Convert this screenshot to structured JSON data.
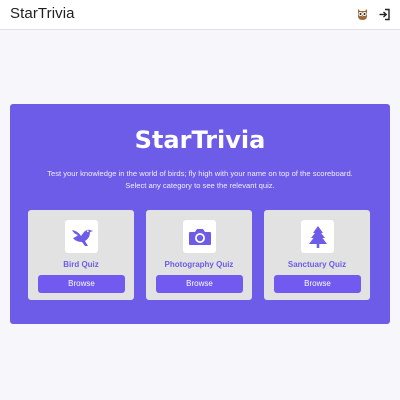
{
  "app": {
    "title": "StarTrivia"
  },
  "topbar": {
    "icons": [
      "owl-icon",
      "sign-in-icon"
    ]
  },
  "hero": {
    "title": "StarTrivia",
    "description": "Test your knowledge in the world of birds; fly high with your name on top of the scoreboard. Select any category to see the relevant quiz.",
    "background_color": "#6c5ce7"
  },
  "cards": [
    {
      "title": "Bird Quiz",
      "icon": "bird-icon",
      "button_label": "Browse"
    },
    {
      "title": "Photography Quiz",
      "icon": "camera-icon",
      "button_label": "Browse"
    },
    {
      "title": "Sanctuary Quiz",
      "icon": "tree-icon",
      "button_label": "Browse"
    }
  ],
  "colors": {
    "accent": "#6c5ce7",
    "card_bg": "#e2e2e2",
    "button_bg": "#7259ef"
  }
}
